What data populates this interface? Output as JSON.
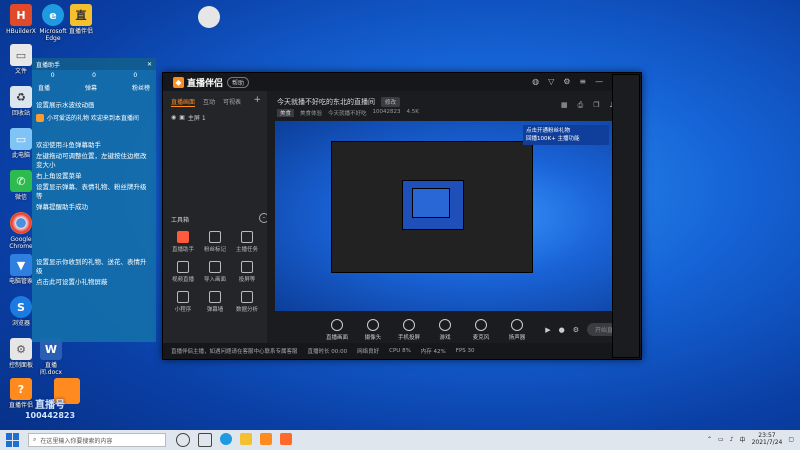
{
  "desktop": {
    "icons": [
      {
        "id": "hbuilderx",
        "label": "HBuilderX",
        "color": "#e04a2a",
        "glyph": "H"
      },
      {
        "id": "edge",
        "label": "Microsoft Edge",
        "color": "#1e9be0",
        "glyph": "e"
      },
      {
        "id": "zhibobanlv-desk",
        "label": "直播伴侣",
        "color": "#f5c030",
        "glyph": "直"
      },
      {
        "id": "file",
        "label": "文件",
        "color": "#e8e8e8",
        "glyph": "▭"
      },
      {
        "id": "recycle",
        "label": "回收站",
        "color": "#dce6ef",
        "glyph": "♻"
      },
      {
        "id": "computer",
        "label": "此电脑",
        "color": "#7fc4f5",
        "glyph": "▭"
      },
      {
        "id": "wechat",
        "label": "微信",
        "color": "#2dbb4f",
        "glyph": "✆"
      },
      {
        "id": "chrome",
        "label": "Google Chrome",
        "color": "#e6e6e6",
        "glyph": "◉"
      },
      {
        "id": "security",
        "label": "电脑管家",
        "color": "#2f7fe0",
        "glyph": "▼"
      },
      {
        "id": "browser",
        "label": "浏览器",
        "color": "#1c7be0",
        "glyph": "S"
      },
      {
        "id": "control",
        "label": "控制面板",
        "color": "#e6e6e6",
        "glyph": "⚙"
      },
      {
        "id": "doc",
        "label": "直播间.docx",
        "color": "#2b5fb4",
        "glyph": "W"
      },
      {
        "id": "live-tile",
        "label": "直播伴侣",
        "color": "#ff8a1e",
        "glyph": "?"
      }
    ],
    "watermark": {
      "line1": "直播号",
      "line2": "100442823"
    }
  },
  "chatPanel": {
    "header": "直播助手",
    "stats": [
      "0",
      "0",
      "0"
    ],
    "tabs": [
      "直播",
      "弹幕",
      "粉丝榜"
    ],
    "messages": [
      "设置展示水波纹动画",
      "欢迎使用斗鱼弹幕助手",
      "左键拖动可调整位置，左键按住边框改变大小",
      "右上角设置菜单",
      "设置显示弹幕、表情礼物、粉丝牌升级等",
      "弹幕提醒助手成功",
      "设置显示你收到的礼物、送花、表情升级",
      "点击此可设置小礼物屏蔽"
    ],
    "gift": "小可爱送的礼物 欢迎来到本直播间"
  },
  "app": {
    "name": "直播伴侣",
    "badge": "帮助",
    "leftTabs": [
      "直播画面",
      "互动",
      "可视表"
    ],
    "scene": "主屏 1",
    "toolsTitle": "工具箱",
    "tools": [
      "直播助手",
      "粉丝标记",
      "主播任务",
      "视频直播",
      "导入画面",
      "投屏等",
      "小程序",
      "弹幕墙",
      "数据分析"
    ],
    "streamTitle": "今天就播不好吃的东北的直播间",
    "editLabel": "修改",
    "meta": {
      "tag": "美食",
      "category": "美食体验",
      "extra": "今天就播不好吃",
      "room": "10042823",
      "count": "4.5K"
    },
    "previewBanner": {
      "line1": "点击开通粉丝礼物",
      "line2": "回播100K+ 主播功能"
    },
    "controls": [
      "直播画面",
      "摄像头",
      "手机投屏",
      "游戏",
      "麦克风",
      "扬声器"
    ],
    "startLabel": "开始直播",
    "statusItems": [
      "直播时长 00:00",
      "网络良好",
      "CPU 8%",
      "内存 42%",
      "FPS 30"
    ],
    "statusNote": "直播伴侣主播，如遇问题请在客服中心联系专属客服"
  },
  "taskbar": {
    "searchPlaceholder": "在这里输入你要搜索的内容",
    "time": "23:57",
    "date": "2021/7/24"
  }
}
